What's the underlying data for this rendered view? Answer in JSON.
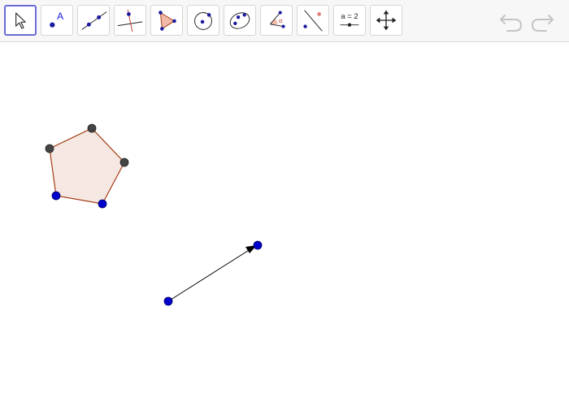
{
  "toolbar": {
    "tools": [
      {
        "name": "move-tool",
        "icon": "arrow-cursor-icon",
        "selected": true
      },
      {
        "name": "point-tool",
        "icon": "point-icon",
        "label": "A"
      },
      {
        "name": "line-tool",
        "icon": "line-through-points-icon"
      },
      {
        "name": "perpendicular-tool",
        "icon": "perpendicular-line-icon"
      },
      {
        "name": "polygon-tool",
        "icon": "polygon-icon"
      },
      {
        "name": "circle-tool",
        "icon": "circle-center-point-icon"
      },
      {
        "name": "conic-tool",
        "icon": "ellipse-icon"
      },
      {
        "name": "angle-tool",
        "icon": "angle-icon",
        "label": "α"
      },
      {
        "name": "reflect-tool",
        "icon": "reflect-about-line-icon"
      },
      {
        "name": "slider-tool",
        "icon": "slider-icon",
        "label": "a = 2"
      },
      {
        "name": "move-graphics-tool",
        "icon": "move-graphics-view-icon"
      }
    ],
    "undo_icon": "undo-icon",
    "redo_icon": "redo-icon"
  },
  "colors": {
    "accent": "#6b6bd6",
    "free_point": "#0000cc",
    "dependent_point": "#444444",
    "polygon_stroke": "#a33c12",
    "polygon_fill": "#f5e8e2",
    "vector": "#000000"
  }
}
